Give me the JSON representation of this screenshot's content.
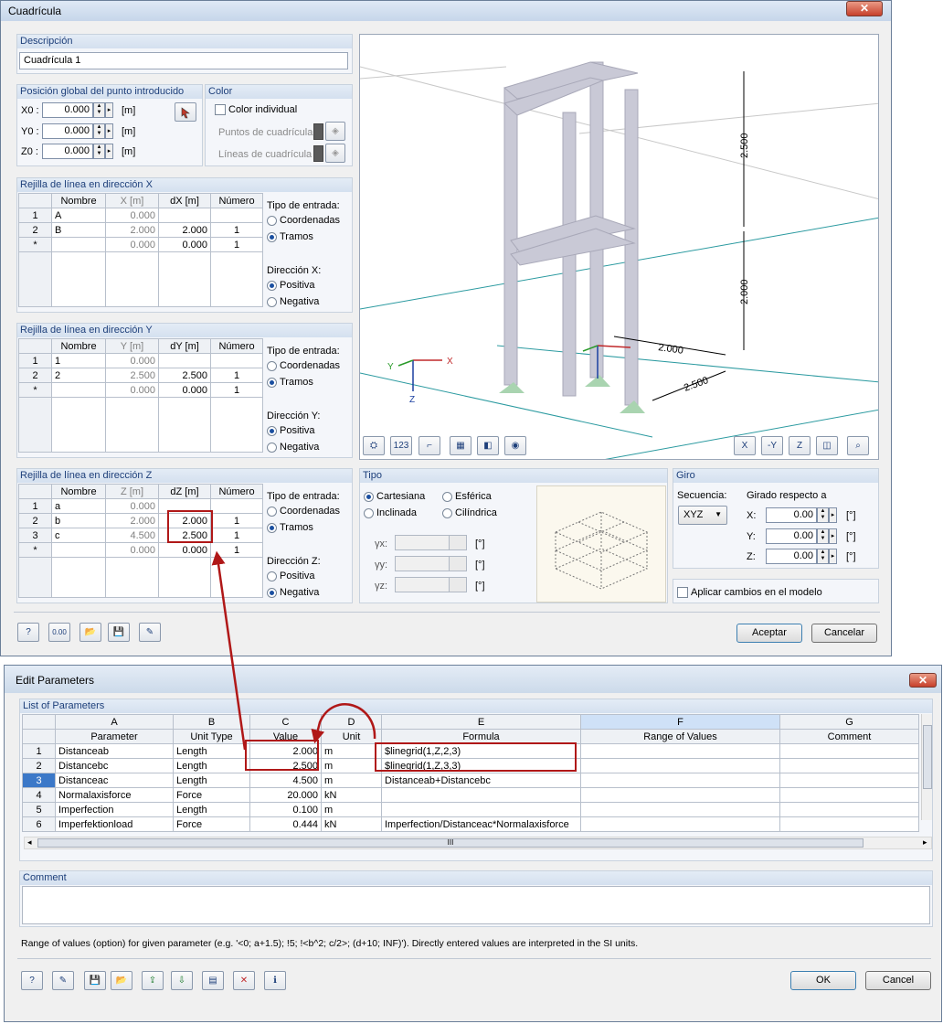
{
  "dlg1": {
    "title": "Cuadrícula",
    "descripcion": {
      "header": "Descripción",
      "value": "Cuadrícula 1"
    },
    "posicion": {
      "header": "Posición global del punto introducido",
      "x0": {
        "label": "X0 :",
        "value": "0.000",
        "unit": "[m]"
      },
      "y0": {
        "label": "Y0 :",
        "value": "0.000",
        "unit": "[m]"
      },
      "z0": {
        "label": "Z0 :",
        "value": "0.000",
        "unit": "[m]"
      }
    },
    "color": {
      "header": "Color",
      "individual": "Color individual",
      "puntos": "Puntos de cuadrícula",
      "lineas": "Líneas de cuadrícula"
    },
    "gridX": {
      "header": "Rejilla de línea en dirección X",
      "cols": [
        "Nombre",
        "X [m]",
        "dX [m]",
        "Número"
      ],
      "rows": [
        {
          "n": "1",
          "name": "A",
          "c": "0.000",
          "d": "",
          "num": ""
        },
        {
          "n": "2",
          "name": "B",
          "c": "2.000",
          "d": "2.000",
          "num": "1"
        },
        {
          "n": "*",
          "name": "",
          "c": "0.000",
          "d": "0.000",
          "num": "1"
        }
      ],
      "tipo": "Tipo de entrada:",
      "coord": "Coordenadas",
      "tramos": "Tramos",
      "dir": "Dirección X:",
      "pos": "Positiva",
      "neg": "Negativa"
    },
    "gridY": {
      "header": "Rejilla de línea en dirección Y",
      "cols": [
        "Nombre",
        "Y [m]",
        "dY [m]",
        "Número"
      ],
      "rows": [
        {
          "n": "1",
          "name": "1",
          "c": "0.000",
          "d": "",
          "num": ""
        },
        {
          "n": "2",
          "name": "2",
          "c": "2.500",
          "d": "2.500",
          "num": "1"
        },
        {
          "n": "*",
          "name": "",
          "c": "0.000",
          "d": "0.000",
          "num": "1"
        }
      ],
      "tipo": "Tipo de entrada:",
      "coord": "Coordenadas",
      "tramos": "Tramos",
      "dir": "Dirección Y:",
      "pos": "Positiva",
      "neg": "Negativa"
    },
    "gridZ": {
      "header": "Rejilla de línea en dirección Z",
      "cols": [
        "Nombre",
        "Z [m]",
        "dZ [m]",
        "Número"
      ],
      "rows": [
        {
          "n": "1",
          "name": "a",
          "c": "0.000",
          "d": "",
          "num": ""
        },
        {
          "n": "2",
          "name": "b",
          "c": "2.000",
          "d": "2.000",
          "num": "1"
        },
        {
          "n": "3",
          "name": "c",
          "c": "4.500",
          "d": "2.500",
          "num": "1"
        },
        {
          "n": "*",
          "name": "",
          "c": "0.000",
          "d": "0.000",
          "num": "1"
        }
      ],
      "tipo": "Tipo de entrada:",
      "coord": "Coordenadas",
      "tramos": "Tramos",
      "dir": "Dirección Z:",
      "pos": "Positiva",
      "neg": "Negativa"
    },
    "tipo": {
      "header": "Tipo",
      "cart": "Cartesiana",
      "esf": "Esférica",
      "incl": "Inclinada",
      "cil": "Cilíndrica",
      "gx": "γx:",
      "gy": "γy:",
      "gz": "γz:",
      "unit": "[°]"
    },
    "giro": {
      "header": "Giro",
      "secuencia": "Secuencia:",
      "seq_value": "XYZ",
      "girado": "Girado respecto a",
      "x": {
        "label": "X:",
        "value": "0.00"
      },
      "y": {
        "label": "Y:",
        "value": "0.00"
      },
      "z": {
        "label": "Z:",
        "value": "0.00"
      },
      "unit": "[°]",
      "aplicar": "Aplicar cambios en el modelo"
    },
    "view": {
      "dim1": "2.500",
      "dim2": "2.000",
      "dim3": "2.000",
      "dim4": "2.500",
      "x": "X",
      "y": "Y",
      "z": "Z"
    },
    "aceptar": "Aceptar",
    "cancelar": "Cancelar"
  },
  "dlg2": {
    "title": "Edit Parameters",
    "list_header": "List of Parameters",
    "col_letters": [
      "A",
      "B",
      "C",
      "D",
      "E",
      "F",
      "G"
    ],
    "cols": [
      "Parameter",
      "Unit Type",
      "Value",
      "Unit",
      "Formula",
      "Range of Values",
      "Comment"
    ],
    "rows": [
      {
        "n": "1",
        "param": "Distanceab",
        "type": "Length",
        "value": "2.000",
        "unit": "m",
        "formula": "$linegrid(1,Z,2,3)"
      },
      {
        "n": "2",
        "param": "Distancebc",
        "type": "Length",
        "value": "2.500",
        "unit": "m",
        "formula": "$linegrid(1,Z,3,3)"
      },
      {
        "n": "3",
        "param": "Distanceac",
        "type": "Length",
        "value": "4.500",
        "unit": "m",
        "formula": "Distanceab+Distancebc"
      },
      {
        "n": "4",
        "param": "Normalaxisforce",
        "type": "Force",
        "value": "20.000",
        "unit": "kN",
        "formula": ""
      },
      {
        "n": "5",
        "param": "Imperfection",
        "type": "Length",
        "value": "0.100",
        "unit": "m",
        "formula": ""
      },
      {
        "n": "6",
        "param": "Imperfektionload",
        "type": "Force",
        "value": "0.444",
        "unit": "kN",
        "formula": "Imperfection/Distanceac*Normalaxisforce"
      }
    ],
    "comment_header": "Comment",
    "hint": "Range of values (option) for given parameter (e.g. '<0; a+1.5); !5; !<b^2; c/2>; (d+10; INF)'). Directly entered values are interpreted in the SI units.",
    "ok": "OK",
    "cancel": "Cancel",
    "scroll_mid": "III"
  }
}
